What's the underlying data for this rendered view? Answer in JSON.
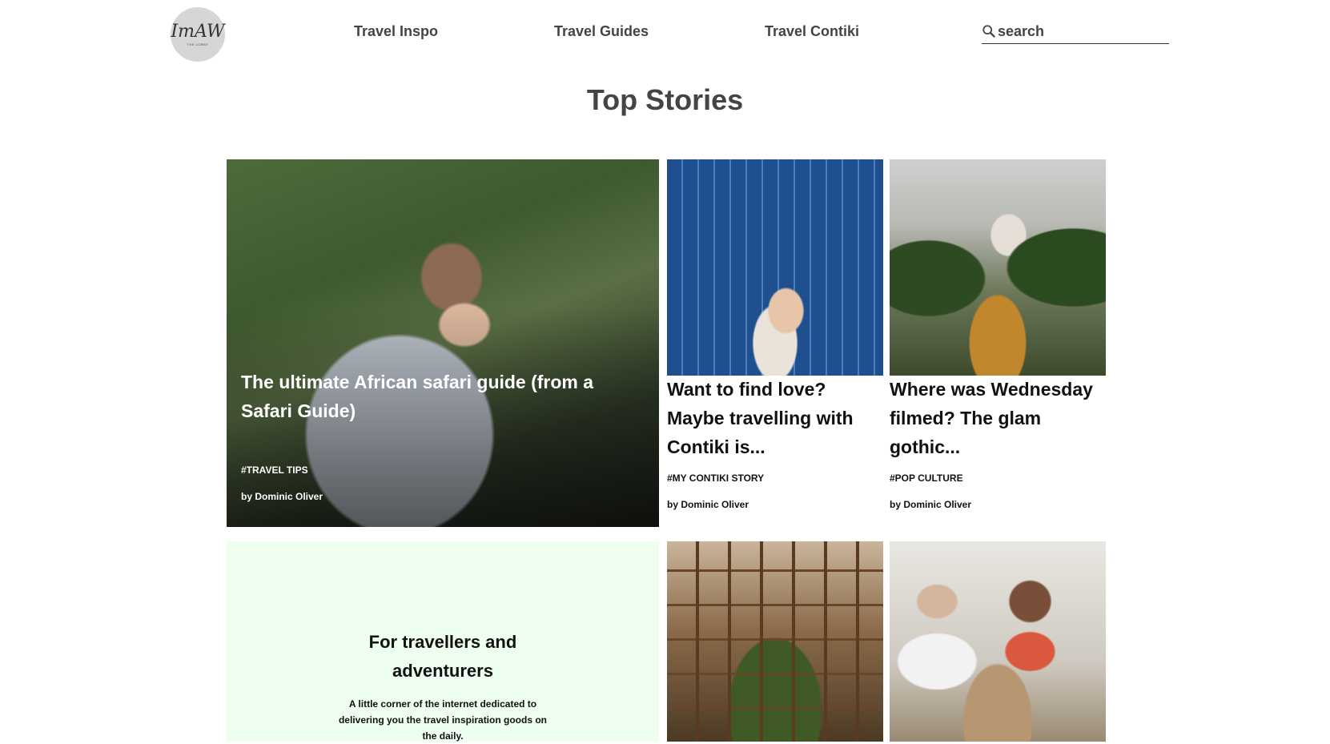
{
  "logo": {
    "mark": "ImAW",
    "sub": "THE LOBBY"
  },
  "nav": {
    "items": [
      {
        "label": "Travel Inspo"
      },
      {
        "label": "Travel Guides"
      },
      {
        "label": "Travel Contiki"
      }
    ],
    "search": {
      "placeholder": "search",
      "icon": "search-icon"
    }
  },
  "main": {
    "title": "Top Stories",
    "feature": {
      "title": "The ultimate African safari guide (from a Safari Guide)",
      "tag": "#TRAVEL TIPS",
      "byline": "by Dominic Oliver"
    },
    "cards": [
      {
        "title": "Want to find love? Maybe travelling with Contiki is...",
        "tag": "#MY CONTIKI STORY",
        "byline": "by Dominic Oliver"
      },
      {
        "title": "Where was Wednesday filmed? The glam gothic...",
        "tag": "#POP CULTURE",
        "byline": "by Dominic Oliver"
      }
    ],
    "promo": {
      "heading": "For travellers and adventurers",
      "text": "A little corner of the internet dedicated to delivering you the travel inspiration goods on the daily."
    }
  },
  "colors": {
    "promo_bg": "#efffef",
    "nav_text": "#444444",
    "title_text": "#444444"
  }
}
